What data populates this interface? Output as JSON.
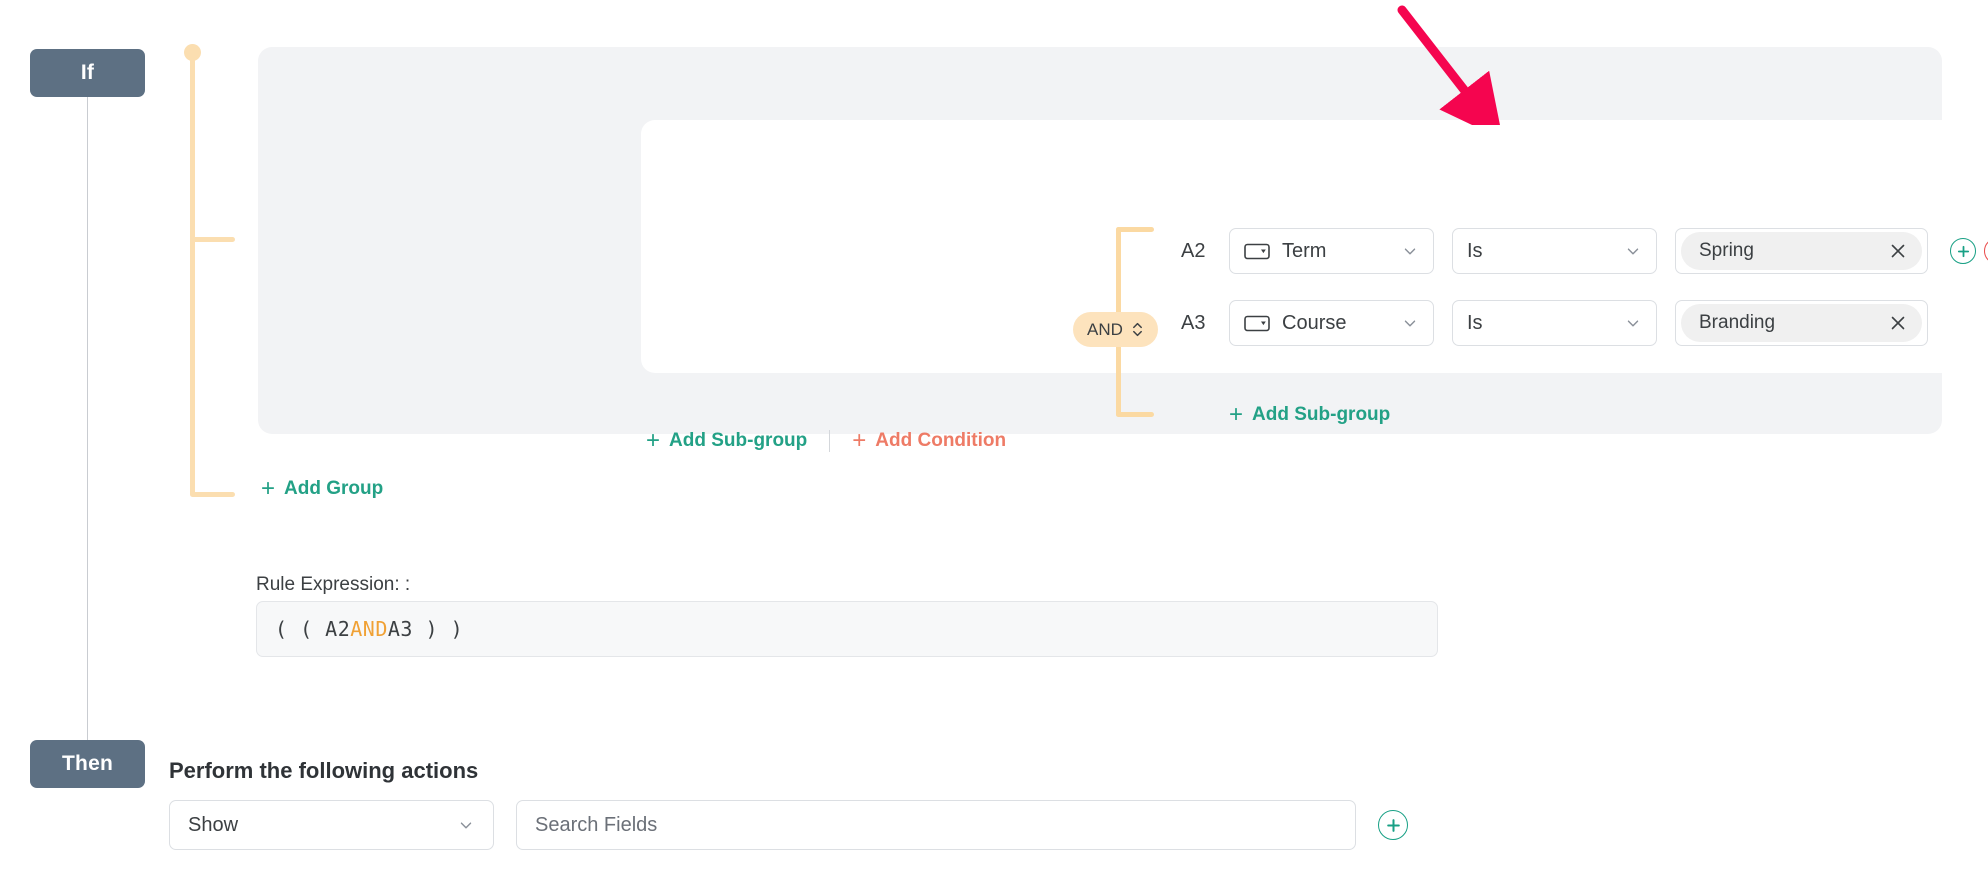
{
  "rail": {
    "if_label": "If",
    "then_label": "Then"
  },
  "group": {
    "delete_icon": "trash-icon",
    "logic_operator": "AND",
    "conditions": [
      {
        "id": "A2",
        "field": "Term",
        "field_icon": "select-box-icon",
        "operator": "Is",
        "value": "Spring",
        "remove_value_icon": "close-icon"
      },
      {
        "id": "A3",
        "field": "Course",
        "field_icon": "select-box-icon",
        "operator": "Is",
        "value": "Branding",
        "remove_value_icon": "close-icon"
      }
    ],
    "add_condition_row_button": "+",
    "remove_condition_row_button": "−",
    "inner_add_subgroup": "Add Sub-group",
    "outer_add_subgroup": "Add Sub-group",
    "outer_add_condition": "Add Condition",
    "add_group": "Add Group",
    "plus_glyph": "+"
  },
  "rule_expression": {
    "label": "Rule Expression: :",
    "prefix": "( ( A2 ",
    "operator": "AND",
    "suffix": " A3 ) )"
  },
  "then_section": {
    "heading": "Perform the following actions",
    "action": "Show",
    "search_placeholder": "Search Fields",
    "search_value": "",
    "add_button_glyph": "+"
  },
  "colors": {
    "badge": "#5d7083",
    "teal": "#23a186",
    "coral": "#ee7b66",
    "orange": "#fbdeb0",
    "operator_orange": "#f0a135",
    "red_minus": "#ea4a4a",
    "annotation_arrow": "#f5054f",
    "outer_card": "#f2f3f5"
  }
}
